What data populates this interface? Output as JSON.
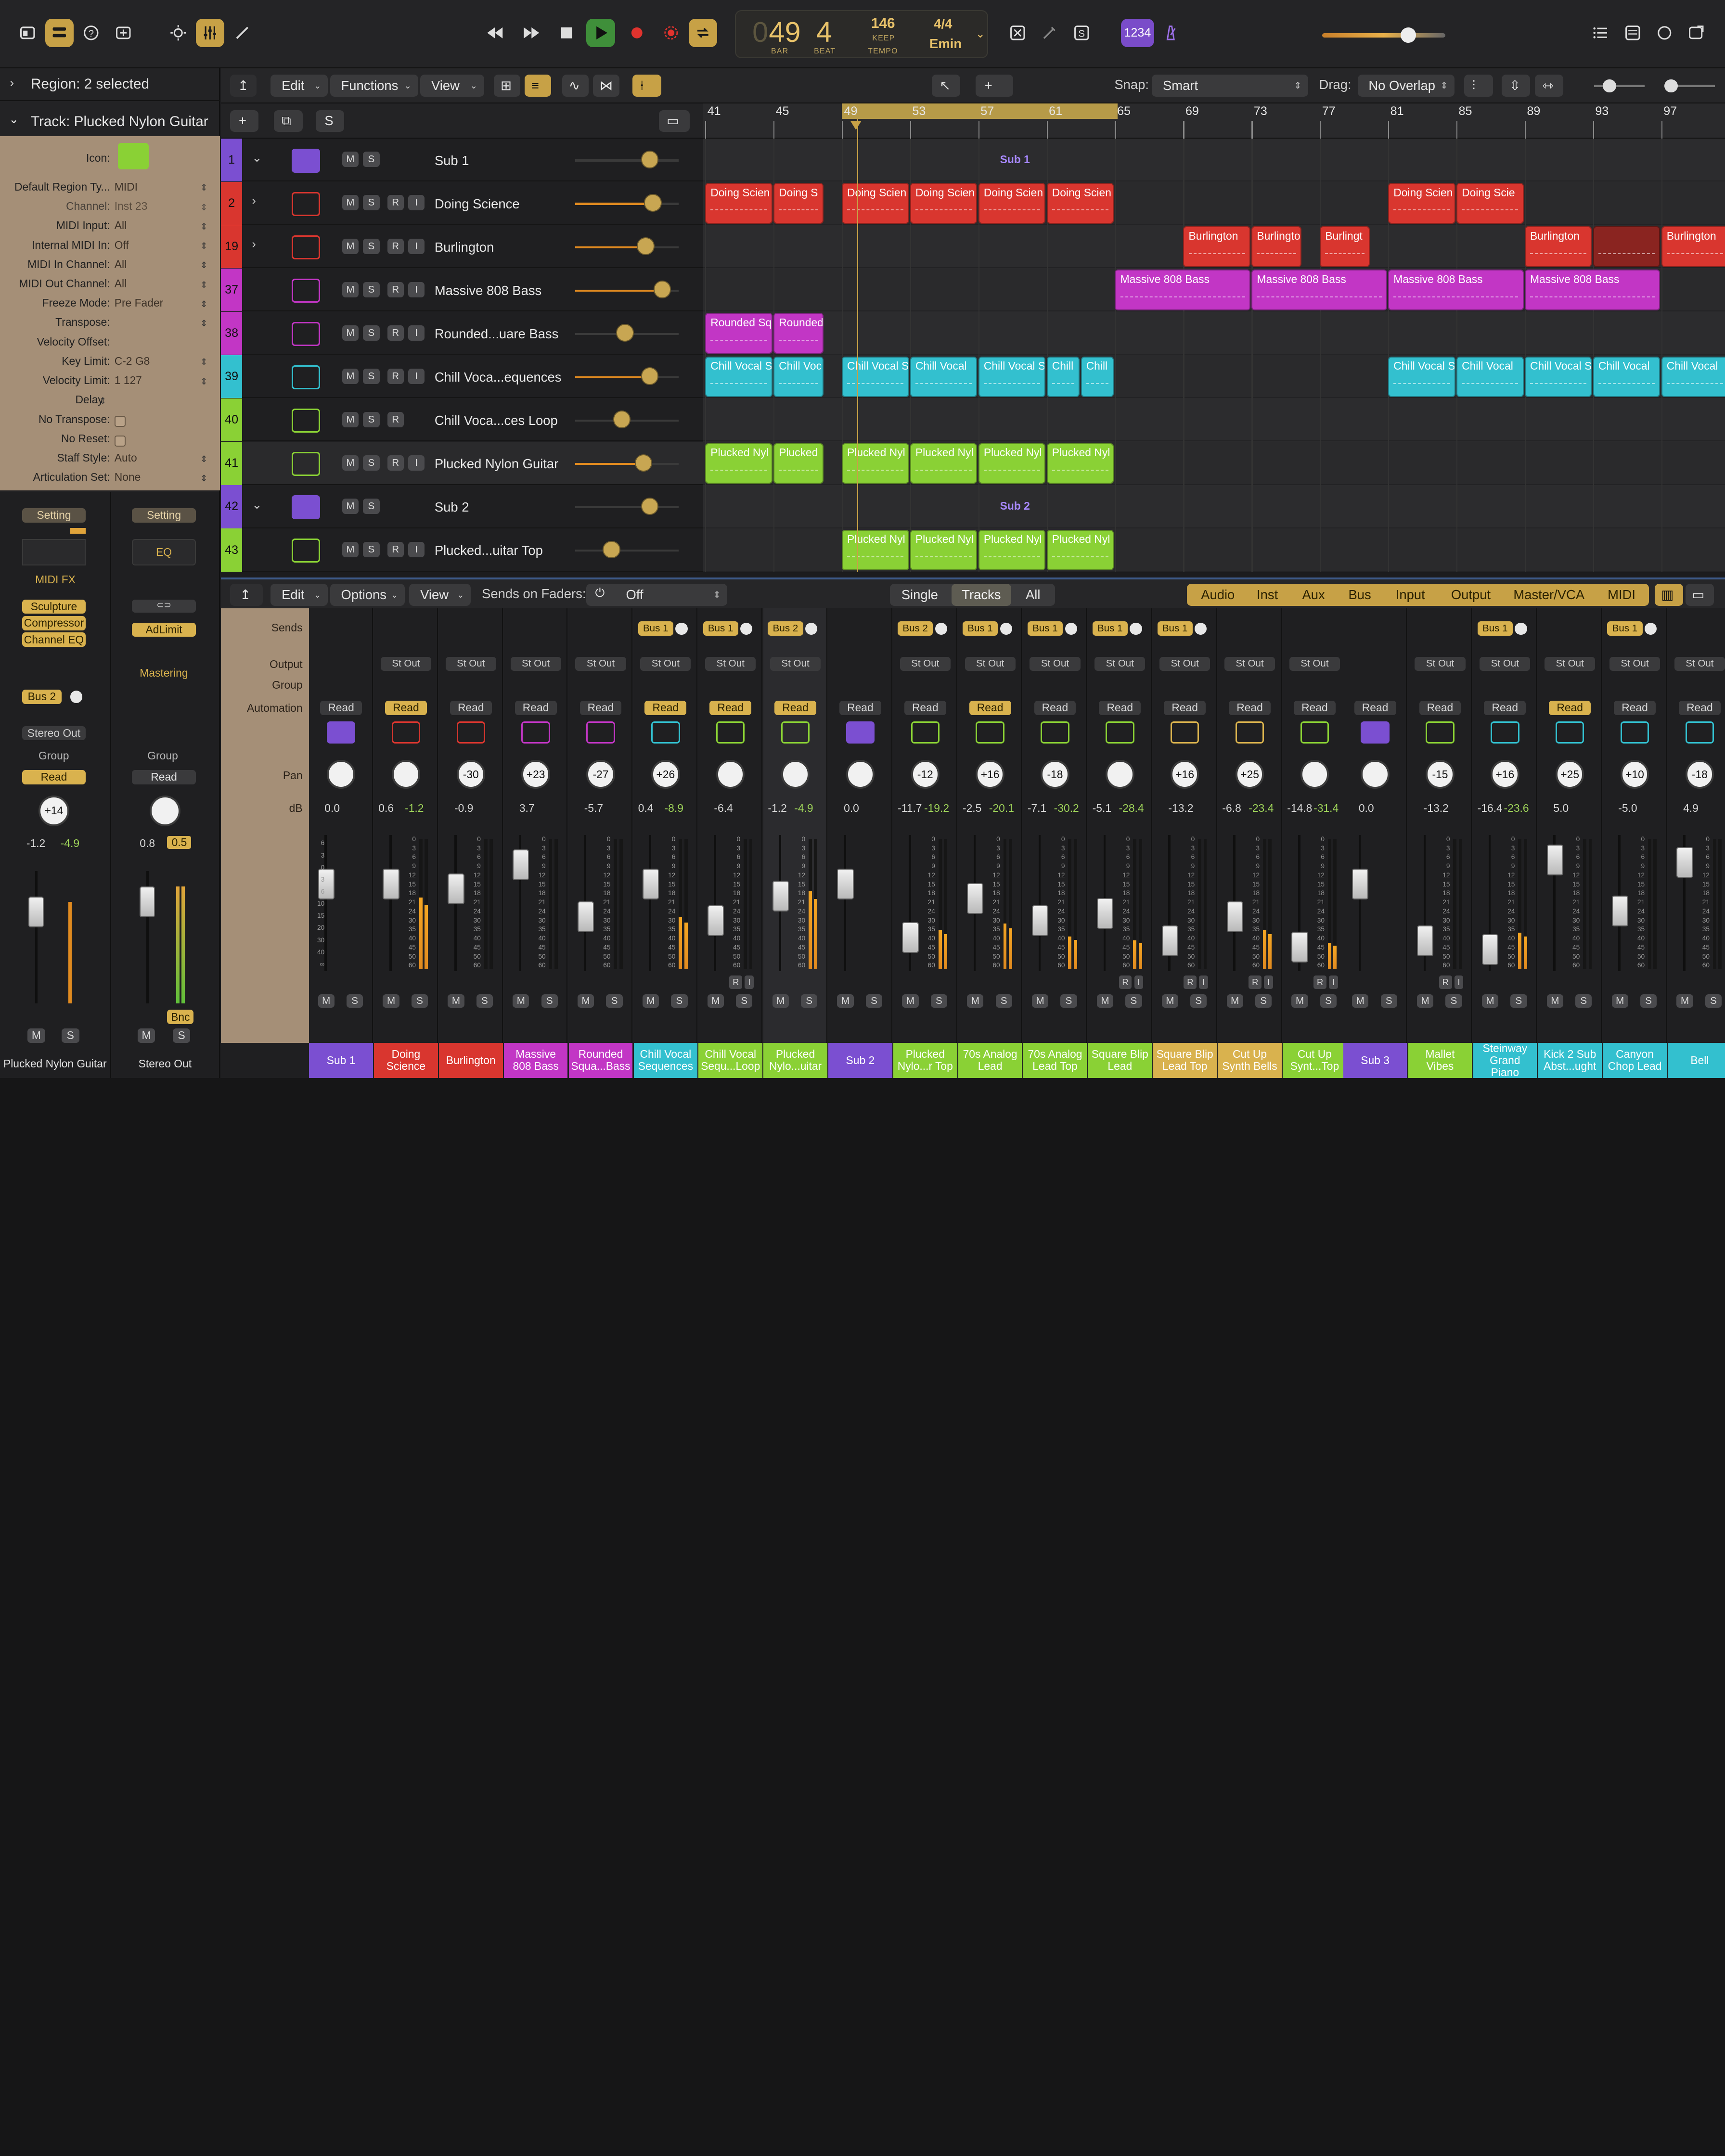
{
  "transport": {
    "bar": "49",
    "bar_label": "BAR",
    "beat": "4",
    "beat_label": "BEAT",
    "tempo": "146",
    "tempo_mode": "KEEP",
    "tempo_label": "TEMPO",
    "signature": "4/4",
    "key": "Emin",
    "count_in": "1234"
  },
  "inspector": {
    "region_header": "Region: 2 selected",
    "track_header": "Track: Plucked Nylon Guitar",
    "params": [
      {
        "label": "Icon:",
        "value": ""
      },
      {
        "label": "Default Region Ty...",
        "value": "MIDI"
      },
      {
        "label": "Channel:",
        "value": "Inst 23"
      },
      {
        "label": "MIDI Input:",
        "value": "All"
      },
      {
        "label": "Internal MIDI In:",
        "value": "Off"
      },
      {
        "label": "MIDI In Channel:",
        "value": "All"
      },
      {
        "label": "MIDI Out Channel:",
        "value": "All"
      },
      {
        "label": "Freeze Mode:",
        "value": "Pre Fader"
      },
      {
        "label": "Transpose:",
        "value": ""
      },
      {
        "label": "Velocity Offset:",
        "value": ""
      },
      {
        "label": "Key Limit:",
        "value": "C-2  G8"
      },
      {
        "label": "Velocity Limit:",
        "value": "1  127"
      },
      {
        "label": "Delay",
        "value": ""
      },
      {
        "label": "No Transpose:",
        "value": ""
      },
      {
        "label": "No Reset:",
        "value": ""
      },
      {
        "label": "Staff Style:",
        "value": "Auto"
      },
      {
        "label": "Articulation Set:",
        "value": "None"
      }
    ],
    "strip_left": {
      "setting": "Setting",
      "midi_fx": "MIDI FX",
      "plugins": [
        "Sculpture",
        "Compressor",
        "Channel EQ"
      ],
      "bus": "Bus 2",
      "output": "Stereo Out",
      "group": "Group",
      "automation": "Read",
      "pan": "+14",
      "db": "-1.2",
      "db_peak": "-4.9",
      "name": "Plucked Nylon Guitar"
    },
    "strip_right": {
      "setting": "Setting",
      "eq": "EQ",
      "plugin": "AdLimit",
      "mastering": "Mastering",
      "group": "Group",
      "automation": "Read",
      "db": "0.8",
      "db_peak": "0.5",
      "bnc": "Bnc",
      "name": "Stereo Out"
    },
    "m": "M",
    "s": "S"
  },
  "track_toolbar": {
    "edit": "Edit",
    "functions": "Functions",
    "view": "View",
    "snap_label": "Snap:",
    "snap_value": "Smart",
    "drag_label": "Drag:",
    "drag_value": "No Overlap",
    "add": "+",
    "s": "S"
  },
  "ruler": [
    "41",
    "45",
    "49",
    "53",
    "57",
    "61",
    "65",
    "69",
    "73",
    "77",
    "81",
    "85",
    "89",
    "93",
    "97"
  ],
  "tracks": [
    {
      "num": "1",
      "name": "Sub 1",
      "color": "#7b4fd1",
      "has_ri": false,
      "has_r": false,
      "expand": "v",
      "vol": 0.72
    },
    {
      "num": "2",
      "name": "Doing Science",
      "color": "#d9362f",
      "has_ri": true,
      "expand": ">",
      "vol": 0.75
    },
    {
      "num": "19",
      "name": "Burlington",
      "color": "#d9362f",
      "has_ri": true,
      "expand": ">",
      "vol": 0.68
    },
    {
      "num": "37",
      "name": "Massive 808 Bass",
      "color": "#c236c5",
      "has_ri": true,
      "expand": "",
      "vol": 0.84
    },
    {
      "num": "38",
      "name": "Rounded...uare Bass",
      "color": "#c236c5",
      "has_ri": true,
      "expand": "",
      "vol": 0.48
    },
    {
      "num": "39",
      "name": "Chill Voca...equences",
      "color": "#33c0cf",
      "has_ri": true,
      "expand": "",
      "vol": 0.72
    },
    {
      "num": "40",
      "name": "Chill Voca...ces Loop",
      "color": "#8ad135",
      "has_ri": false,
      "has_r": true,
      "expand": "",
      "vol": 0.45
    },
    {
      "num": "41",
      "name": "Plucked Nylon Guitar",
      "color": "#8ad135",
      "has_ri": true,
      "expand": "",
      "vol": 0.66
    },
    {
      "num": "42",
      "name": "Sub 2",
      "color": "#7b4fd1",
      "has_ri": false,
      "has_r": false,
      "expand": "v",
      "vol": 0.72
    },
    {
      "num": "43",
      "name": "Plucked...uitar Top",
      "color": "#8ad135",
      "has_ri": true,
      "expand": "",
      "vol": 0.35
    }
  ],
  "track_buttons": {
    "m": "M",
    "s": "S",
    "r": "R",
    "i": "I"
  },
  "sub_labels": {
    "sub1": "Sub 1",
    "sub2": "Sub 2"
  },
  "regions": [
    {
      "lane": 1,
      "bar": 41,
      "len": 4,
      "label": "Doing Scien"
    },
    {
      "lane": 1,
      "bar": 45,
      "len": 3,
      "label": "Doing S"
    },
    {
      "lane": 1,
      "bar": 49,
      "len": 4,
      "label": "Doing Scien"
    },
    {
      "lane": 1,
      "bar": 53,
      "len": 4,
      "label": "Doing Scien"
    },
    {
      "lane": 1,
      "bar": 57,
      "len": 4,
      "label": "Doing Scien"
    },
    {
      "lane": 1,
      "bar": 61,
      "len": 4,
      "label": "Doing Scien"
    },
    {
      "lane": 1,
      "bar": 81,
      "len": 4,
      "label": "Doing Scien"
    },
    {
      "lane": 1,
      "bar": 85,
      "len": 4,
      "label": "Doing Scie"
    },
    {
      "lane": 2,
      "bar": 69,
      "len": 4,
      "label": "Burlington"
    },
    {
      "lane": 2,
      "bar": 73,
      "len": 3,
      "label": "Burlingto"
    },
    {
      "lane": 2,
      "bar": 77,
      "len": 3,
      "label": "Burlingt"
    },
    {
      "lane": 2,
      "bar": 89,
      "len": 4,
      "label": "Burlington"
    },
    {
      "lane": 2,
      "bar": 93,
      "len": 4,
      "label": "",
      "dim": true
    },
    {
      "lane": 2,
      "bar": 97,
      "len": 4,
      "label": "Burlington"
    },
    {
      "lane": 3,
      "bar": 65,
      "len": 8,
      "label": "Massive 808 Bass"
    },
    {
      "lane": 3,
      "bar": 73,
      "len": 8,
      "label": "Massive 808 Bass"
    },
    {
      "lane": 3,
      "bar": 81,
      "len": 8,
      "label": "Massive 808 Bass"
    },
    {
      "lane": 3,
      "bar": 89,
      "len": 8,
      "label": "Massive 808 Bass"
    },
    {
      "lane": 4,
      "bar": 41,
      "len": 4,
      "label": "Rounded Sq"
    },
    {
      "lane": 4,
      "bar": 45,
      "len": 3,
      "label": "Rounded"
    },
    {
      "lane": 5,
      "bar": 41,
      "len": 4,
      "label": "Chill Vocal S"
    },
    {
      "lane": 5,
      "bar": 45,
      "len": 3,
      "label": "Chill Voc"
    },
    {
      "lane": 5,
      "bar": 49,
      "len": 4,
      "label": "Chill Vocal S"
    },
    {
      "lane": 5,
      "bar": 53,
      "len": 4,
      "label": "Chill Vocal"
    },
    {
      "lane": 5,
      "bar": 57,
      "len": 4,
      "label": "Chill Vocal S"
    },
    {
      "lane": 5,
      "bar": 61,
      "len": 2,
      "label": "Chill"
    },
    {
      "lane": 5,
      "bar": 63,
      "len": 2,
      "label": "Chill"
    },
    {
      "lane": 5,
      "bar": 81,
      "len": 4,
      "label": "Chill Vocal S"
    },
    {
      "lane": 5,
      "bar": 85,
      "len": 4,
      "label": "Chill Vocal"
    },
    {
      "lane": 5,
      "bar": 89,
      "len": 4,
      "label": "Chill Vocal S"
    },
    {
      "lane": 5,
      "bar": 93,
      "len": 4,
      "label": "Chill Vocal"
    },
    {
      "lane": 5,
      "bar": 97,
      "len": 4,
      "label": "Chill Vocal"
    },
    {
      "lane": 7,
      "bar": 41,
      "len": 4,
      "label": "Plucked Nyl"
    },
    {
      "lane": 7,
      "bar": 45,
      "len": 3,
      "label": "Plucked"
    },
    {
      "lane": 7,
      "bar": 49,
      "len": 4,
      "label": "Plucked Nyl"
    },
    {
      "lane": 7,
      "bar": 53,
      "len": 4,
      "label": "Plucked Nyl"
    },
    {
      "lane": 7,
      "bar": 57,
      "len": 4,
      "label": "Plucked Nyl"
    },
    {
      "lane": 7,
      "bar": 61,
      "len": 4,
      "label": "Plucked Nyl"
    },
    {
      "lane": 9,
      "bar": 49,
      "len": 4,
      "label": "Plucked Nyl"
    },
    {
      "lane": 9,
      "bar": 53,
      "len": 4,
      "label": "Plucked Nyl"
    },
    {
      "lane": 9,
      "bar": 57,
      "len": 4,
      "label": "Plucked Nyl"
    },
    {
      "lane": 9,
      "bar": 61,
      "len": 4,
      "label": "Plucked Nyl"
    }
  ],
  "mixer_toolbar": {
    "edit": "Edit",
    "options": "Options",
    "view": "View",
    "sends_on_faders": "Sends on Faders:",
    "sends_value": "Off",
    "single": "Single",
    "tracks": "Tracks",
    "all": "All",
    "filters": [
      "Audio",
      "Inst",
      "Aux",
      "Bus",
      "Input",
      "Output",
      "Master/VCA",
      "MIDI"
    ]
  },
  "mixer_labels": {
    "sends": "Sends",
    "output": "Output",
    "group": "Group",
    "automation": "Automation",
    "pan": "Pan",
    "db": "dB"
  },
  "mixer_buttons": {
    "m": "M",
    "s": "S",
    "r": "R",
    "i": "I",
    "stout": "St Out"
  },
  "channels": [
    {
      "name": "Sub 1",
      "color": "#7b4fd1",
      "bus": "",
      "out": false,
      "read_on": false,
      "pan": "",
      "db": "0.0",
      "peak": "",
      "fader": 0.72,
      "meter": 0,
      "ri": false
    },
    {
      "name": "Doing Science",
      "color": "#d9362f",
      "bus": "",
      "out": true,
      "read_on": true,
      "pan": "",
      "db": "0.6",
      "peak": "-1.2",
      "fader": 0.72,
      "meter": 0.55,
      "ri": false
    },
    {
      "name": "Burlington",
      "color": "#d9362f",
      "bus": "",
      "out": true,
      "read_on": false,
      "pan": "-30",
      "db": "-0.9",
      "peak": "",
      "fader": 0.68,
      "meter": 0,
      "ri": false
    },
    {
      "name": "Massive 808 Bass",
      "color": "#c236c5",
      "bus": "",
      "out": true,
      "read_on": false,
      "pan": "+23",
      "db": "3.7",
      "peak": "",
      "fader": 0.88,
      "meter": 0,
      "ri": false
    },
    {
      "name": "Rounded Squa...Bass",
      "color": "#c236c5",
      "bus": "",
      "out": true,
      "read_on": false,
      "pan": "-27",
      "db": "-5.7",
      "peak": "",
      "fader": 0.45,
      "meter": 0,
      "ri": false
    },
    {
      "name": "Chill Vocal Sequences",
      "color": "#33c0cf",
      "bus": "Bus 1",
      "out": true,
      "read_on": true,
      "pan": "+26",
      "db": "0.4",
      "peak": "-8.9",
      "fader": 0.72,
      "meter": 0.4,
      "ri": false
    },
    {
      "name": "Chill Vocal Sequ...Loop",
      "color": "#8ad135",
      "bus": "Bus 1",
      "out": true,
      "read_on": true,
      "pan": "",
      "db": "-6.4",
      "peak": "",
      "fader": 0.42,
      "meter": 0,
      "ri": true
    },
    {
      "name": "Plucked Nylo...uitar",
      "color": "#8ad135",
      "bus": "Bus 2",
      "out": true,
      "read_on": true,
      "pan": "",
      "db": "-1.2",
      "peak": "-4.9",
      "fader": 0.62,
      "meter": 0.6,
      "ri": false
    },
    {
      "name": "Sub 2",
      "color": "#7b4fd1",
      "bus": "",
      "out": false,
      "read_on": false,
      "pan": "",
      "db": "0.0",
      "peak": "",
      "fader": 0.72,
      "meter": 0,
      "ri": false
    },
    {
      "name": "Plucked Nylo...r Top",
      "color": "#8ad135",
      "bus": "Bus 2",
      "out": true,
      "read_on": false,
      "pan": "-12",
      "db": "-11.7",
      "peak": "-19.2",
      "fader": 0.28,
      "meter": 0.3,
      "ri": false
    },
    {
      "name": "70s Analog Lead",
      "color": "#8ad135",
      "bus": "Bus 1",
      "out": true,
      "read_on": true,
      "pan": "+16",
      "db": "-2.5",
      "peak": "-20.1",
      "fader": 0.6,
      "meter": 0.35,
      "ri": false
    },
    {
      "name": "70s Analog Lead Top",
      "color": "#8ad135",
      "bus": "Bus 1",
      "out": true,
      "read_on": false,
      "pan": "-18",
      "db": "-7.1",
      "peak": "-30.2",
      "fader": 0.42,
      "meter": 0.25,
      "ri": false
    },
    {
      "name": "Square Blip Lead",
      "color": "#8ad135",
      "bus": "Bus 1",
      "out": true,
      "read_on": false,
      "pan": "",
      "db": "-5.1",
      "peak": "-28.4",
      "fader": 0.48,
      "meter": 0.22,
      "ri": true
    },
    {
      "name": "Square Blip Lead Top",
      "color": "#d9b24e",
      "bus": "Bus 1",
      "out": true,
      "read_on": false,
      "pan": "+16",
      "db": "-13.2",
      "peak": "",
      "fader": 0.25,
      "meter": 0,
      "ri": true
    },
    {
      "name": "Cut Up Synth Bells",
      "color": "#d9b24e",
      "bus": "",
      "out": true,
      "read_on": false,
      "pan": "+25",
      "db": "-6.8",
      "peak": "-23.4",
      "fader": 0.45,
      "meter": 0.3,
      "ri": true
    },
    {
      "name": "Cut Up Synt...Top",
      "color": "#8ad135",
      "bus": "",
      "out": true,
      "read_on": false,
      "pan": "",
      "db": "-14.8",
      "peak": "-31.4",
      "fader": 0.2,
      "meter": 0.2,
      "ri": true
    },
    {
      "name": "Sub 3",
      "color": "#7b4fd1",
      "bus": "",
      "out": false,
      "read_on": false,
      "pan": "",
      "db": "0.0",
      "peak": "",
      "fader": 0.72,
      "meter": 0,
      "ri": false
    },
    {
      "name": "Mallet Vibes",
      "color": "#8ad135",
      "bus": "",
      "out": true,
      "read_on": false,
      "pan": "-15",
      "db": "-13.2",
      "peak": "",
      "fader": 0.25,
      "meter": 0,
      "ri": true
    },
    {
      "name": "Steinway Grand Piano",
      "color": "#33c0cf",
      "bus": "Bus 1",
      "out": true,
      "read_on": false,
      "pan": "+16",
      "db": "-16.4",
      "peak": "-23.6",
      "fader": 0.18,
      "meter": 0.28,
      "ri": false
    },
    {
      "name": "Kick 2 Sub Abst...ught",
      "color": "#33c0cf",
      "bus": "",
      "out": true,
      "read_on": true,
      "pan": "+25",
      "db": "5.0",
      "peak": "",
      "fader": 0.92,
      "meter": 0,
      "ri": false
    },
    {
      "name": "Canyon Chop Lead",
      "color": "#33c0cf",
      "bus": "Bus 1",
      "out": true,
      "read_on": false,
      "pan": "+10",
      "db": "-5.0",
      "peak": "",
      "fader": 0.5,
      "meter": 0,
      "ri": false
    },
    {
      "name": "Bell",
      "color": "#33c0cf",
      "bus": "",
      "out": true,
      "read_on": false,
      "pan": "-18",
      "db": "4.9",
      "peak": "",
      "fader": 0.9,
      "meter": 0,
      "ri": false
    }
  ],
  "read_label": "Read",
  "fader_scale": [
    "6",
    "3",
    "0",
    "3",
    "6",
    "10",
    "15",
    "20",
    "30",
    "40",
    "∞"
  ],
  "meter_scale": [
    "0",
    "3",
    "6",
    "9",
    "12",
    "15",
    "18",
    "21",
    "24",
    "30",
    "35",
    "40",
    "45",
    "50",
    "60"
  ]
}
